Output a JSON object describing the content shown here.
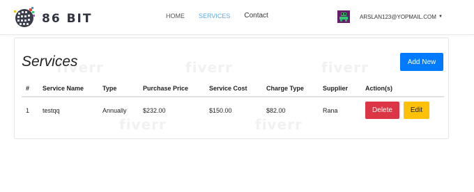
{
  "brand": {
    "name": "86 BIT",
    "logo_icon": "globe-grid-icon"
  },
  "nav": {
    "home": "HOME",
    "services": "SERVICES",
    "contact": "Contact",
    "active_color": "#5aa9e6"
  },
  "user": {
    "email": "ARSLAN123@YOPMAIL.COM",
    "avatar_icon": "pixel-avatar-icon",
    "caret_icon": "caret-down-icon"
  },
  "page": {
    "title": "Services",
    "add_button": "Add New",
    "watermark": "fiverr"
  },
  "table": {
    "headers": [
      "#",
      "Service Name",
      "Type",
      "Purchase Price",
      "Service Cost",
      "Charge Type",
      "Supplier",
      "Action(s)"
    ],
    "rows": [
      {
        "num": "1",
        "name": "testqq",
        "type": "Annually",
        "purchase_price": "$232.00",
        "service_cost": "$150.00",
        "charge_type": "$82.00",
        "supplier": "Rana",
        "delete_label": "Delete",
        "edit_label": "Edit"
      }
    ]
  },
  "colors": {
    "primary": "#007bff",
    "danger": "#dc3545",
    "warning": "#ffc107"
  }
}
